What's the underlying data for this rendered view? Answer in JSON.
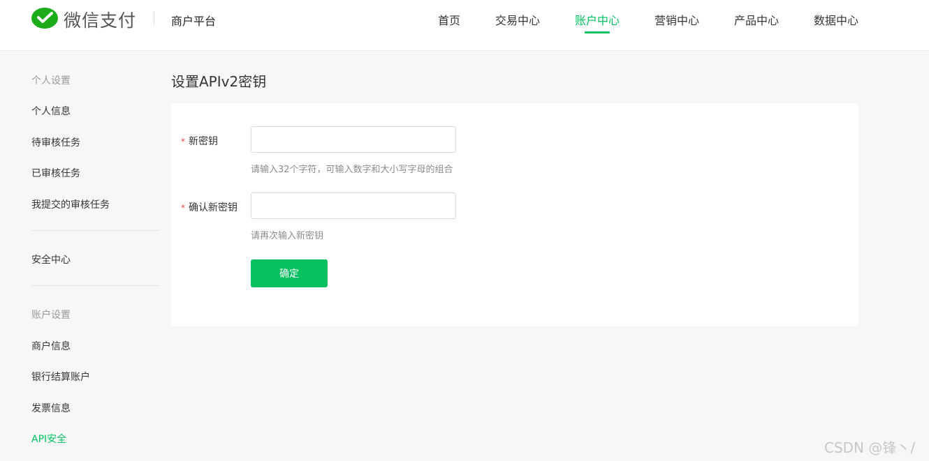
{
  "header": {
    "brand": "微信支付",
    "platform": "商户平台",
    "nav": [
      {
        "label": "首页"
      },
      {
        "label": "交易中心"
      },
      {
        "label": "账户中心"
      },
      {
        "label": "营销中心"
      },
      {
        "label": "产品中心"
      },
      {
        "label": "数据中心"
      }
    ],
    "active_nav": "账户中心"
  },
  "sidebar": {
    "groups": [
      {
        "title": "个人设置",
        "items": [
          "个人信息",
          "待审核任务",
          "已审核任务",
          "我提交的审核任务"
        ]
      },
      {
        "title": "",
        "items": [
          "安全中心"
        ]
      },
      {
        "title": "账户设置",
        "items": [
          "商户信息",
          "银行结算账户",
          "发票信息",
          "API安全"
        ]
      }
    ],
    "active_item": "API安全"
  },
  "main": {
    "title": "设置APIv2密钥",
    "form": {
      "required_mark": "*",
      "new_key": {
        "label": "新密钥",
        "value": "",
        "placeholder": "",
        "hint": "请输入32个字符，可输入数字和大小写字母的组合"
      },
      "confirm_key": {
        "label": "确认新密钥",
        "value": "",
        "placeholder": "",
        "hint": "请再次输入新密钥"
      },
      "submit_label": "确定"
    }
  },
  "watermark": "CSDN @锋丶/",
  "colors": {
    "accent": "#07c160",
    "required": "#e64340",
    "background": "#f7f7f7"
  }
}
